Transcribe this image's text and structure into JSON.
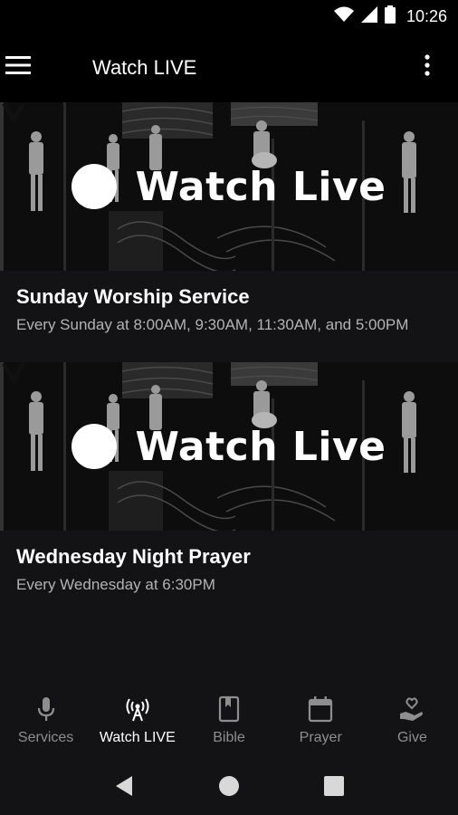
{
  "status_bar": {
    "time": "10:26",
    "icons": [
      "wifi-icon",
      "signal-icon",
      "battery-icon"
    ]
  },
  "app_bar": {
    "title": "Watch LIVE",
    "menu_icon": "hamburger-menu-icon",
    "overflow_icon": "more-vert-icon"
  },
  "cards": [
    {
      "banner_text": "Watch Live",
      "title": "Sunday Worship Service",
      "subtitle": "Every Sunday at 8:00AM, 9:30AM, 11:30AM, and 5:00PM"
    },
    {
      "banner_text": "Watch Live",
      "title": "Wednesday Night Prayer",
      "subtitle": "Every Wednesday at 6:30PM"
    }
  ],
  "bottom_nav": [
    {
      "label": "Services",
      "icon": "microphone-icon",
      "active": false
    },
    {
      "label": "Watch LIVE",
      "icon": "broadcast-icon",
      "active": true
    },
    {
      "label": "Bible",
      "icon": "book-icon",
      "active": false
    },
    {
      "label": "Prayer",
      "icon": "calendar-icon",
      "active": false
    },
    {
      "label": "Give",
      "icon": "heart-hand-icon",
      "active": false
    }
  ],
  "system_nav": [
    "back-icon",
    "home-icon",
    "recents-icon"
  ],
  "colors": {
    "background": "#131315",
    "bar": "#000000",
    "active": "#ffffff",
    "inactive": "#8e8e8e"
  }
}
